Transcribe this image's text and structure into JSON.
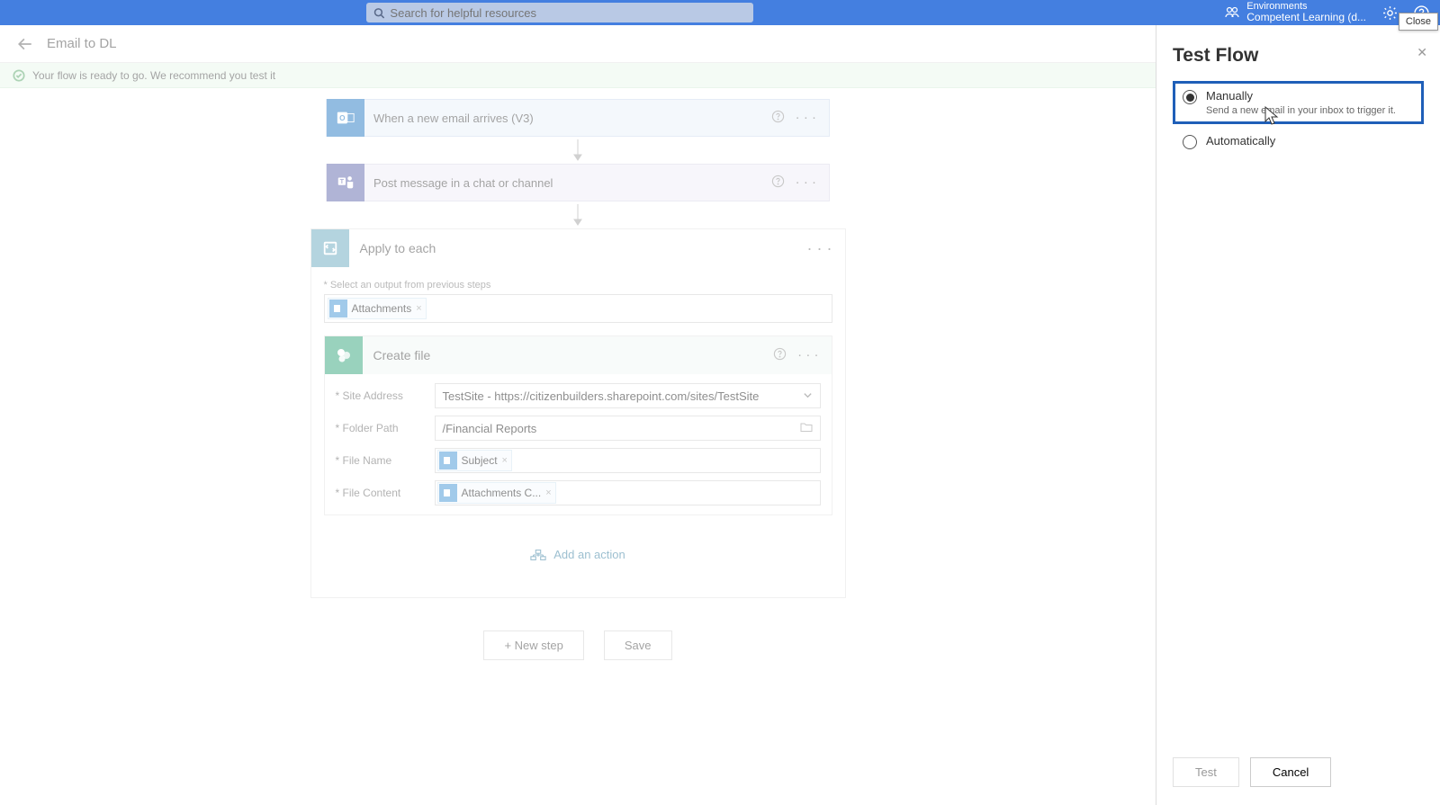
{
  "header": {
    "search_placeholder": "Search for helpful resources",
    "env_label": "Environments",
    "env_name": "Competent Learning (d...",
    "close_tooltip": "Close"
  },
  "breadcrumb": {
    "title": "Email to DL"
  },
  "notice": {
    "text": "Your flow is ready to go. We recommend you test it"
  },
  "steps": {
    "trigger": "When a new email arrives (V3)",
    "teams": "Post message in a chat or channel",
    "apply_each": "Apply to each",
    "select_output_label": "Select an output from previous steps",
    "attachments_token": "Attachments",
    "create_file": "Create file",
    "fields": {
      "site_label": "Site Address",
      "site_value": "TestSite - https://citizenbuilders.sharepoint.com/sites/TestSite",
      "folder_label": "Folder Path",
      "folder_value": "/Financial Reports",
      "filename_label": "File Name",
      "filename_token": "Subject",
      "filecontent_label": "File Content",
      "filecontent_token": "Attachments C..."
    },
    "add_action": "Add an action"
  },
  "buttons": {
    "new_step": "+ New step",
    "save": "Save"
  },
  "panel": {
    "title": "Test Flow",
    "manually": "Manually",
    "manually_sub": "Send a new email in your inbox to trigger it.",
    "automatically": "Automatically",
    "test": "Test",
    "cancel": "Cancel"
  }
}
